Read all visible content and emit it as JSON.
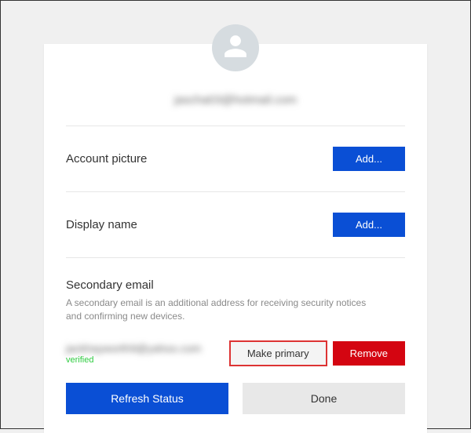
{
  "account": {
    "primary_email": "jascha03@hotmail.com",
    "picture_label": "Account picture",
    "display_name_label": "Display name",
    "add_button": "Add..."
  },
  "secondary": {
    "title": "Secondary email",
    "description": "A secondary email is an additional address for receiving security notices and confirming new devices.",
    "email": "jackhayworth9@yahoo.com",
    "status": "verified",
    "make_primary": "Make primary",
    "remove": "Remove"
  },
  "actions": {
    "refresh": "Refresh Status",
    "done": "Done"
  }
}
